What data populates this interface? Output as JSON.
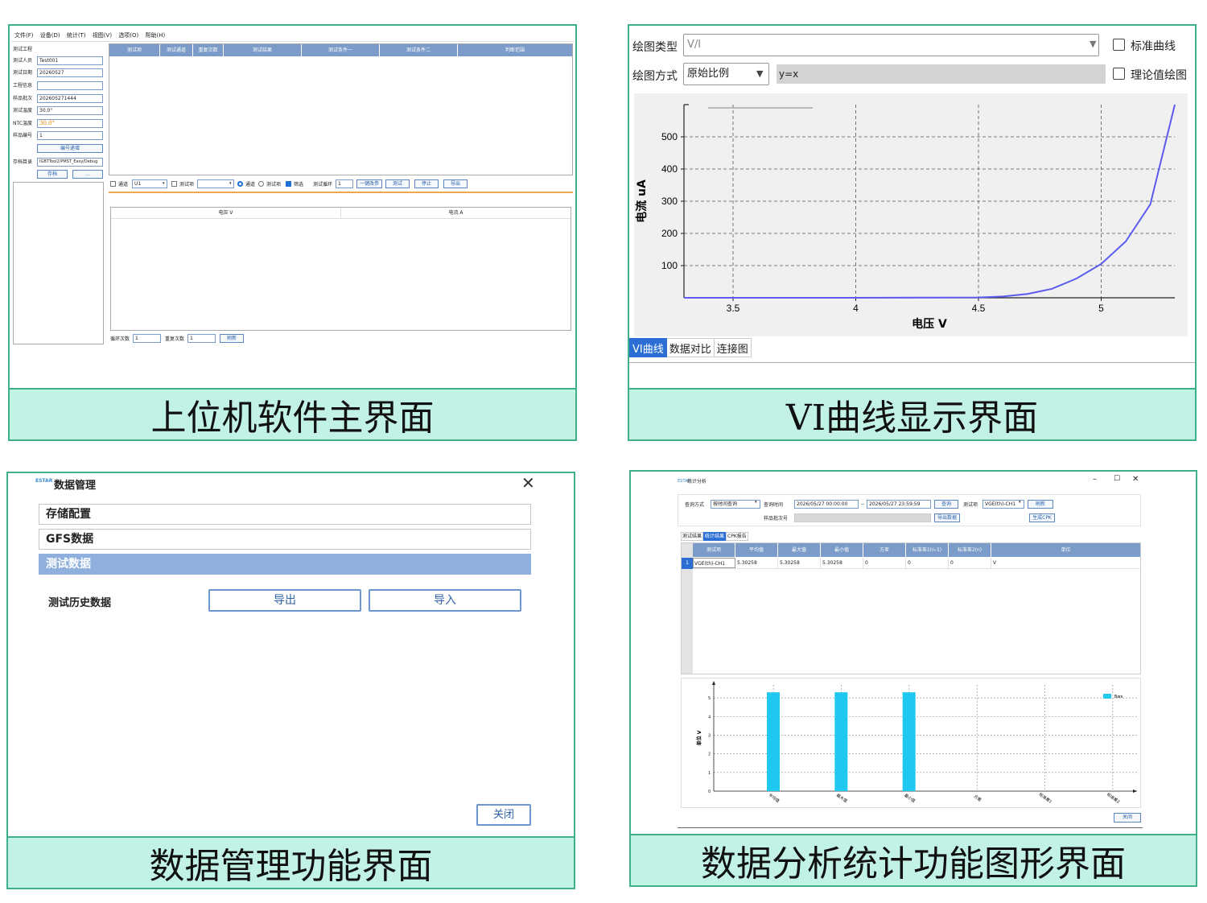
{
  "panel1": {
    "caption": "上位机软件主界面",
    "menu": [
      "文件(F)",
      "设备(D)",
      "统计(T)",
      "视图(V)",
      "选项(O)",
      "帮助(H)"
    ],
    "form": {
      "labels": [
        "测试工程",
        "测试人员",
        "测试日期",
        "工程信息",
        "样品批次",
        "测试温度",
        "NTC温度",
        "样品编号"
      ],
      "values": [
        "",
        "Test001",
        "20260527",
        "",
        "202605271444",
        "30.0°",
        "30.0°",
        "1"
      ],
      "number_button": "编号递增",
      "save_dir_label": "存档目录",
      "save_dir_value": "IGBTTool2/PMST_Easy/Debug",
      "save_button": "存档",
      "browse_button": "..."
    },
    "table_headers": [
      "测试项",
      "测试通道",
      "重复次数",
      "测试结果",
      "测试条件一",
      "测试条件二",
      "判断范围"
    ],
    "toolbar": {
      "channel_label": "通道",
      "channel_value": "U1",
      "item_label": "测试项",
      "radio1": "通道",
      "radio2": "测试项",
      "filter_label": "筛选",
      "loop_label": "测试循环",
      "loop_value": "1",
      "once_button": "一键改参",
      "test_button": "测试",
      "stop_button": "停止",
      "export_button": "导出"
    },
    "data_headers": [
      "电压 V",
      "电流 A"
    ],
    "bottom": {
      "loop_count_label": "循环次数",
      "loop_count_value": "1",
      "repeat_label": "重复次数",
      "repeat_value": "1",
      "refresh_button": "刷新"
    }
  },
  "panel2": {
    "caption": "VI曲线显示界面",
    "plot_type_label": "绘图类型",
    "plot_type_value": "V/I",
    "plot_mode_label": "绘图方式",
    "plot_mode_value": "原始比例",
    "formula": "y=x",
    "std_curve_label": "标准曲线",
    "theory_label": "理论值绘图",
    "tabs": [
      "VI曲线",
      "数据对比",
      "连接图"
    ],
    "chart_data": {
      "type": "line",
      "xlabel": "电压  V",
      "ylabel": "电流  uA",
      "xlim": [
        3.3,
        5.3
      ],
      "ylim": [
        0,
        600
      ],
      "x_ticks": [
        "3.5",
        "4",
        "4.5",
        "5"
      ],
      "y_ticks": [
        "100",
        "200",
        "300",
        "400",
        "500"
      ],
      "grid": true,
      "series": [
        {
          "color": "#5b5bf0",
          "x": [
            3.3,
            3.5,
            4.0,
            4.5,
            4.6,
            4.7,
            4.8,
            4.9,
            5.0,
            5.1,
            5.2,
            5.3
          ],
          "y": [
            0,
            0,
            0,
            1,
            4,
            12,
            28,
            60,
            105,
            175,
            290,
            600
          ]
        }
      ]
    }
  },
  "panel3": {
    "caption": "数据管理功能界面",
    "title": "数据管理",
    "items": [
      "存储配置",
      "GFS数据",
      "测试数据"
    ],
    "history_label": "测试历史数据",
    "export_button": "导出",
    "import_button": "导入",
    "close_button": "关闭"
  },
  "panel4": {
    "caption": "数据分析统计功能图形界面",
    "title": "统计分析",
    "query_label": "查询方式",
    "query_value": "按时间查询",
    "time_label": "查询时间",
    "time_start": "2026/05/27 00:00:00",
    "time_sep": "--",
    "time_end": "2026/05/27 23:59:59",
    "query_button": "查询",
    "item_label": "测试项",
    "item_value": "VGE(th)-CH1",
    "refresh_button": "刷新",
    "batch_label": "样品批次号",
    "export_button": "导出数据",
    "cpk_button": "生成CPK",
    "tabs": [
      "测试结果",
      "统计结果",
      "CPK报告"
    ],
    "table_headers": [
      "测试项",
      "平均值",
      "最大值",
      "最小值",
      "方差",
      "标准差1(n-1)",
      "标准差2(n)",
      "单位"
    ],
    "row_index": "1",
    "row": [
      "VGE(th)-CH1",
      "5.30258",
      "5.30258",
      "5.30258",
      "0",
      "0",
      "0",
      "V"
    ],
    "close_button": "关闭",
    "chart_data": {
      "type": "bar",
      "categories": [
        "平均值",
        "最大值",
        "最小值",
        "方差",
        "标准差1",
        "标准差2"
      ],
      "series": [
        {
          "name": "Bars",
          "values": [
            5.30258,
            5.30258,
            5.30258,
            0,
            0,
            0
          ],
          "color": "#1ec8ef"
        }
      ],
      "ylabel": "单位  V",
      "ylim": [
        0,
        5.7
      ],
      "y_ticks": [
        "0",
        "1",
        "2",
        "3",
        "4",
        "5"
      ],
      "grid": true,
      "legend": "top-right"
    }
  }
}
